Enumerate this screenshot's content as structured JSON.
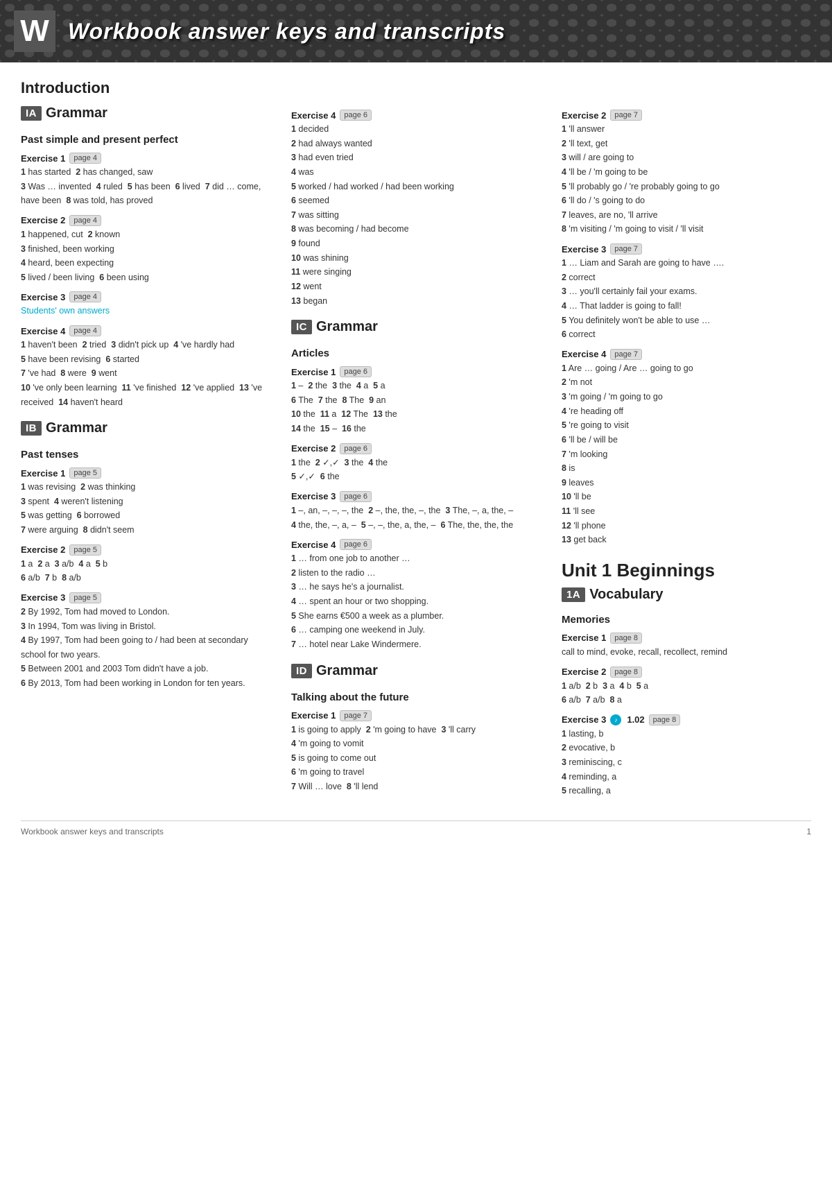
{
  "header": {
    "w_label": "W",
    "title": "Workbook answer keys and transcripts"
  },
  "introduction": {
    "label": "Introduction"
  },
  "col1": {
    "ia_badge": "IA",
    "ia_label": "Grammar",
    "ia_sub": "Past simple and present perfect",
    "ia_ex1_label": "Exercise 1",
    "ia_ex1_page": "page 4",
    "ia_ex1_content": "1 has started   2 has changed, saw\n3 Was … invented   4 ruled   5 has been   6 lived   7 did … come, have been   8 was told, has proved",
    "ia_ex2_label": "Exercise 2",
    "ia_ex2_page": "page 4",
    "ia_ex2_content": "1 happened, cut   2 known\n3 finished, been working\n4 heard, been expecting\n5 lived / been living   6 been using",
    "ia_ex3_label": "Exercise 3",
    "ia_ex3_page": "page 4",
    "ia_ex3_content": "Students' own answers",
    "ia_ex4_label": "Exercise 4",
    "ia_ex4_page": "page 4",
    "ia_ex4_content": "1 haven't been   2 tried   3 didn't pick up   4 've hardly had\n5 have been revising   6 started\n7 've had   8 were   9 went\n10 've only been learning   11 've finished   12 've applied   13 've received   14 haven't heard",
    "ib_badge": "IB",
    "ib_label": "Grammar",
    "ib_sub": "Past tenses",
    "ib_ex1_label": "Exercise 1",
    "ib_ex1_page": "page 5",
    "ib_ex1_content": "1 was revising   2 was thinking\n3 spent   4 weren't listening\n5 was getting   6 borrowed\n7 were arguing   8 didn't seem",
    "ib_ex2_label": "Exercise 2",
    "ib_ex2_page": "page 5",
    "ib_ex2_content": "1 a   2 a   3 a/b   4 a   5 b\n6 a/b   7 b   8 a/b",
    "ib_ex3_label": "Exercise 3",
    "ib_ex3_page": "page 5",
    "ib_ex3_items": [
      "2 By 1992, Tom had moved to London.",
      "3 In 1994, Tom was living in Bristol.",
      "4 By 1997, Tom had been going to / had been at secondary school for two years.",
      "5 Between 2001 and 2003 Tom didn't have a job.",
      "6 By 2013, Tom had been working in London for ten years."
    ]
  },
  "col2": {
    "ic_ex4_label": "Exercise 4",
    "ic_ex4_page": "page 6",
    "ic_ex4_content": "1 decided\n2 had always wanted\n3 had even tried\n4 was\n5 worked / had worked / had been working\n6 seemed\n7 was sitting\n8 was becoming / had become\n9 found\n10 was shining\n11 were singing\n12 went\n13 began",
    "ic_badge": "IC",
    "ic_label": "Grammar",
    "ic_sub": "Articles",
    "ic_ex1_label": "Exercise 1",
    "ic_ex1_page": "page 6",
    "ic_ex1_content": "1 –   2 the   3 the   4 a   5 a\n6 The   7 the   8 The   9 an\n10 the   11 a   12 The   13 the\n14 the   15 –   16 the",
    "ic_ex2_label": "Exercise 2",
    "ic_ex2_page": "page 6",
    "ic_ex2_content": "1 the   2 ✓,✓   3 the   4 the\n5 ✓,✓   6 the",
    "ic_ex3_label": "Exercise 3",
    "ic_ex3_page": "page 6",
    "ic_ex3_content": "1 –, an, –, –, –, the   2 –, the, the, –, the   3 The, –, a, the, –\n4 the, the, –, a, –   5 –, –, the, a, the, –   6 The, the, the, the",
    "ic_ex4_items": [
      "1 … from one job to another …",
      "2 listen to the radio …",
      "3 … he says he's a journalist.",
      "4 … spent an hour or two shopping.",
      "5 She earns €500 a week as a plumber.",
      "6 … camping one weekend in July.",
      "7 … hotel near Lake Windermere."
    ],
    "id_badge": "ID",
    "id_label": "Grammar",
    "id_sub": "Talking about the future",
    "id_ex1_label": "Exercise 1",
    "id_ex1_page": "page 7",
    "id_ex1_content": "1 is going to apply   2 'm going to have   3 'll carry\n4 'm going to vomit\n5 is going to come out\n6 'm going to travel\n7 Will … love   8 'll lend"
  },
  "col3": {
    "id_ex2_label": "Exercise 2",
    "id_ex2_page": "page 7",
    "id_ex2_content": "1 'll answer\n2 'll text, get\n3 will / are going to\n4 'll be / 'm going to be\n5 'll probably go / 're probably going to go\n6 'll do / 's going to do\n7 leaves, are no, 'll arrive\n8 'm visiting / 'm going to visit / 'll visit",
    "id_ex3_label": "Exercise 3",
    "id_ex3_page": "page 7",
    "id_ex3_items": [
      "1 … Liam and Sarah are going to have ….",
      "2 correct",
      "3 … you'll certainly fail your exams.",
      "4 … That ladder is going to fall!",
      "5 You definitely won't be able to use …",
      "6 correct"
    ],
    "id_ex4_label": "Exercise 4",
    "id_ex4_page": "page 7",
    "id_ex4_content": "1 Are … going / Are … going to go\n2 'm not\n3 'm going / 'm going to go\n4 're heading off\n5 're going to visit\n6 'll be / will be\n7 'm looking\n8 is\n9 leaves\n10 'll be\n11 'll see\n12 'll phone\n13 get back",
    "unit1_title": "Unit 1 Beginnings",
    "unit1a_badge": "1A",
    "unit1a_label": "Vocabulary",
    "unit1a_sub": "Memories",
    "unit1a_ex1_label": "Exercise 1",
    "unit1a_ex1_page": "page 8",
    "unit1a_ex1_content": "call to mind, evoke, recall, recollect, remind",
    "unit1a_ex2_label": "Exercise 2",
    "unit1a_ex2_page": "page 8",
    "unit1a_ex2_content": "1 a/b   2 b   3 a   4 b   5 a\n6 a/b   7 a/b   8 a",
    "unit1a_ex3_label": "Exercise 3",
    "unit1a_ex3_page": "page 8",
    "unit1a_ex3_audio": "1.02",
    "unit1a_ex3_items": [
      "1 lasting, b",
      "2 evocative, b",
      "3 reminiscing, c",
      "4 reminding, a",
      "5 recalling, a"
    ]
  },
  "footer": {
    "left": "Workbook answer keys and transcripts",
    "right": "1"
  }
}
